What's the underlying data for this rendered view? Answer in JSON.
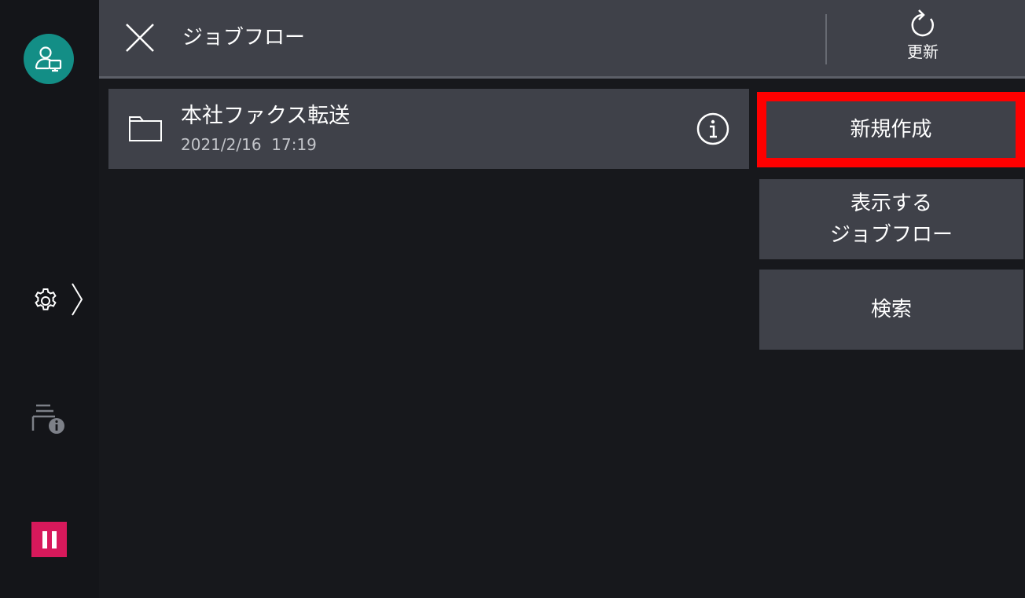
{
  "header": {
    "title": "ジョブフロー",
    "refresh_label": "更新"
  },
  "list": {
    "items": [
      {
        "name": "本社ファクス転送",
        "date": "2021/2/16  17:19",
        "icon": "folder-icon"
      }
    ]
  },
  "actions": {
    "new_label": "新規作成",
    "display_line1": "表示する",
    "display_line2": "ジョブフロー",
    "search_label": "検索"
  },
  "sidebar": {
    "icons": [
      "user-monitor-icon",
      "gear-icon",
      "chevron-right-icon",
      "device-info-icon",
      "pause-icon"
    ]
  },
  "colors": {
    "accent_teal": "#138e86",
    "pause_red": "#d7195b",
    "highlight": "#ff0000",
    "panel": "#3f4149",
    "background": "#17181c"
  }
}
